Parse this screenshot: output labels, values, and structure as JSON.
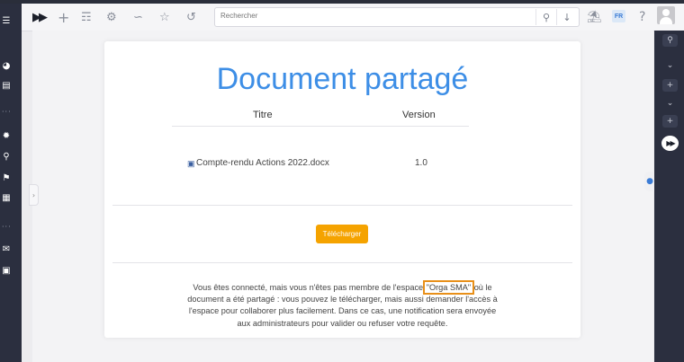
{
  "topbar": {
    "search": {
      "placeholder": "Rechercher"
    },
    "lang": "FR"
  },
  "document": {
    "title": "Document partagé",
    "columns": {
      "title": "Titre",
      "version": "Version"
    },
    "file": {
      "name": "Compte-rendu Actions 2022.docx",
      "version": "1.0"
    },
    "download_label": "Télécharger",
    "notice": {
      "before": "Vous êtes connecté, mais vous n'êtes pas membre de l'espace ",
      "space": "\"Orga SMA\"",
      "line1_end": " où le",
      "line2": "document a été partagé : vous pouvez le télécharger, mais aussi demander l'accès à",
      "line3": "l'espace pour collaborer plus facilement. Dans ce cas, une notification sera envoyée",
      "line4": "aux administrateurs pour valider ou refuser votre requête."
    }
  },
  "colors": {
    "accent": "#3d8ee6",
    "button": "#f5a300",
    "highlight": "#e8901a",
    "sidebar": "#2b2f3f"
  }
}
